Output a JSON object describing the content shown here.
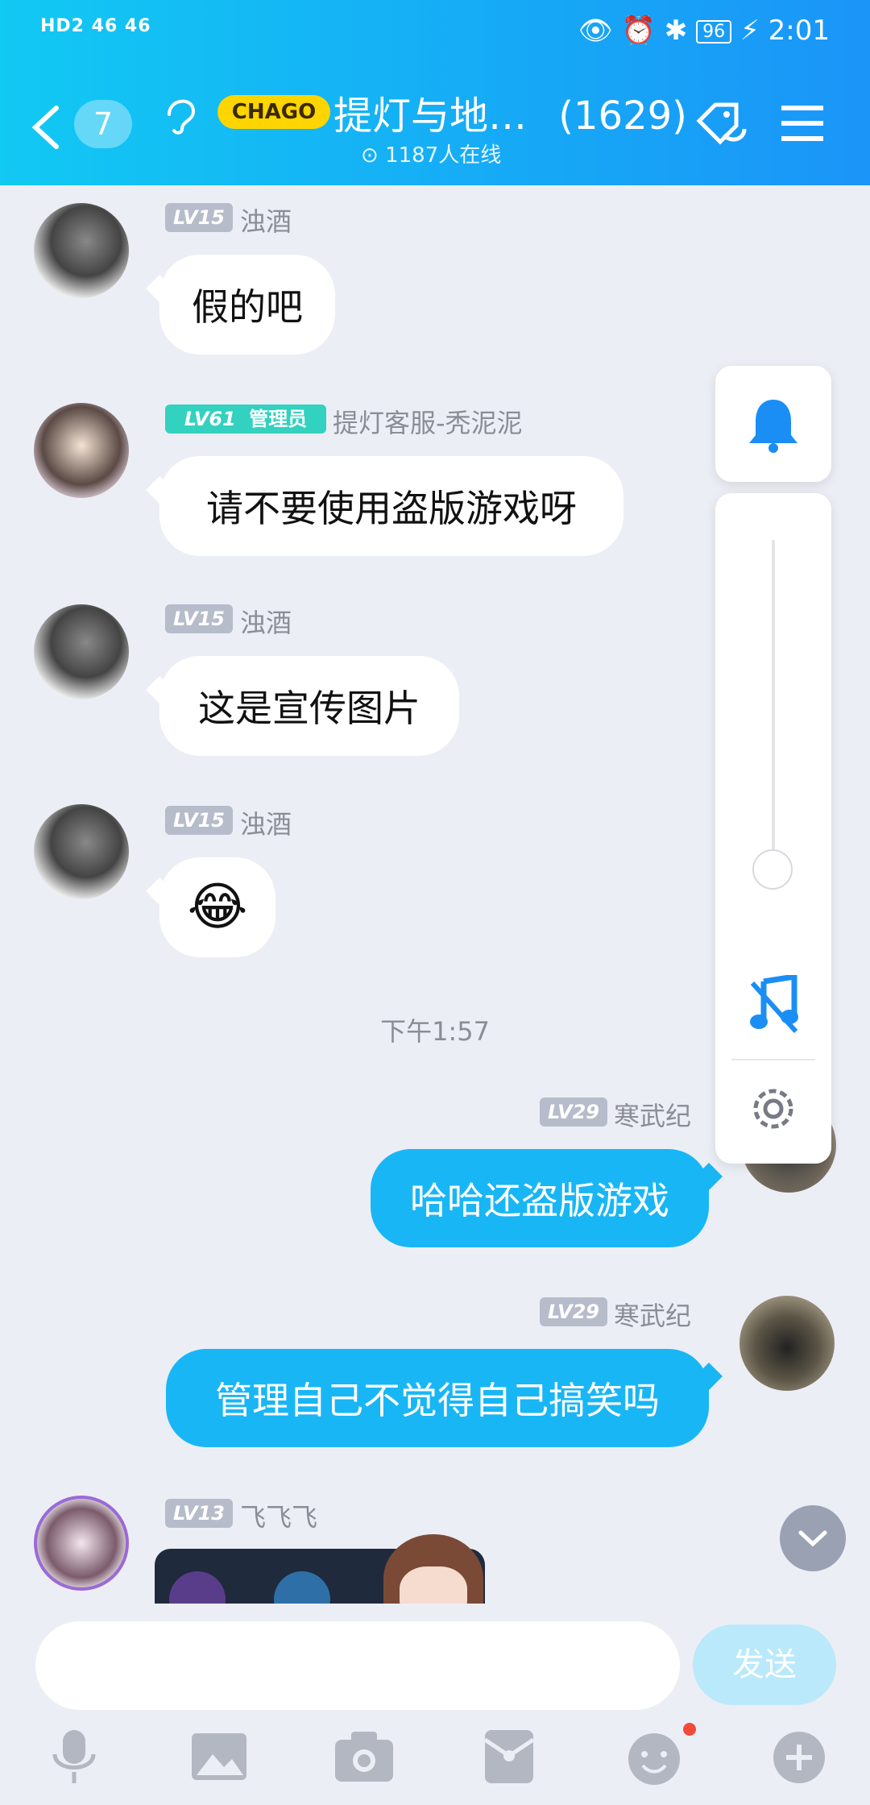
{
  "status_bar": {
    "left": "HD2 46 46",
    "battery": "96",
    "time": "2:01"
  },
  "header": {
    "back_count": "7",
    "logo_text": "CHAGO",
    "title": "提灯与地…",
    "member_count": "(1629)",
    "online": "1187人在线"
  },
  "messages": [
    {
      "level": "LV15",
      "name": "浊酒",
      "text": "假的吧"
    },
    {
      "level": "LV61",
      "role": "管理员",
      "name": "提灯客服-秃泥泥",
      "text": "请不要使用盗版游戏呀"
    },
    {
      "level": "LV15",
      "name": "浊酒",
      "text": "这是宣传图片"
    },
    {
      "level": "LV15",
      "name": "浊酒",
      "text": "😂"
    },
    {
      "level": "LV29",
      "name": "寒武纪",
      "text": "哈哈还盗版游戏"
    },
    {
      "level": "LV29",
      "name": "寒武纪",
      "text": "管理自己不觉得自己搞笑吗"
    },
    {
      "level": "LV13",
      "name": "飞飞飞",
      "text": ""
    }
  ],
  "timestamp": "下午1:57",
  "volume_level": 0.1,
  "input": {
    "placeholder": "",
    "send_label": "发送"
  },
  "colors": {
    "accent": "#19b6f5",
    "admin": "#33d1bf",
    "level_badge": "#b7bccb"
  }
}
